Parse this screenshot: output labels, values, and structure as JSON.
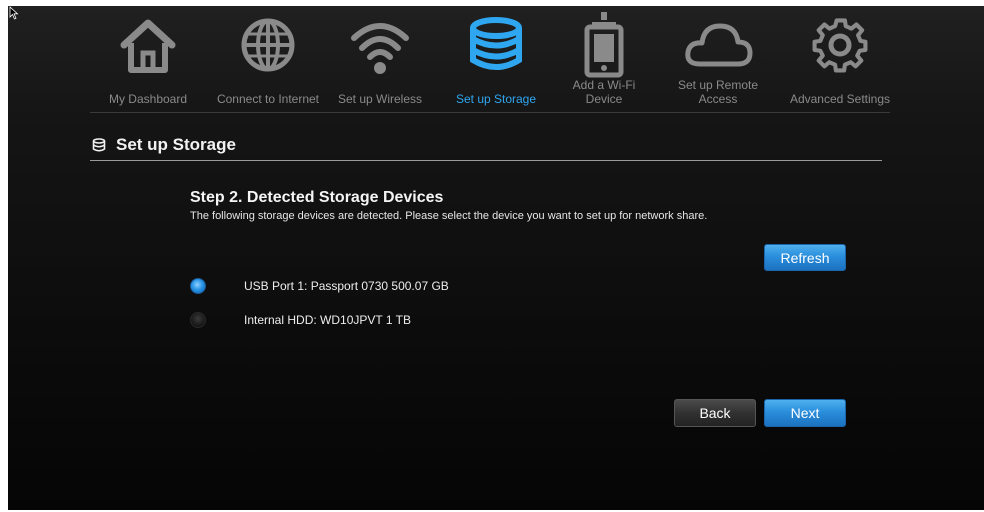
{
  "nav": {
    "items": [
      {
        "label": "My Dashboard",
        "icon": "home-icon",
        "active": false
      },
      {
        "label": "Connect to Internet",
        "icon": "globe-icon",
        "active": false
      },
      {
        "label": "Set up Wireless",
        "icon": "wifi-icon",
        "active": false
      },
      {
        "label": "Set up Storage",
        "icon": "storage-icon",
        "active": true
      },
      {
        "label": "Add a Wi-Fi\nDevice",
        "icon": "tablet-icon",
        "active": false
      },
      {
        "label": "Set up Remote\nAccess",
        "icon": "cloud-icon",
        "active": false
      },
      {
        "label": "Advanced Settings",
        "icon": "gear-icon",
        "active": false
      }
    ]
  },
  "section": {
    "title": "Set up Storage",
    "icon": "storage-icon"
  },
  "step": {
    "title": "Step 2. Detected Storage Devices",
    "description": "The following storage devices are detected. Please select the device you want to set up for network share."
  },
  "buttons": {
    "refresh": "Refresh",
    "back": "Back",
    "next": "Next"
  },
  "devices": [
    {
      "label": "USB Port 1:  Passport 0730  500.07 GB",
      "selected": true
    },
    {
      "label": "Internal HDD:  WD10JPVT 1 TB",
      "selected": false
    }
  ],
  "colors": {
    "accent": "#2fa6f0",
    "nav_inactive": "#8a8a8a",
    "button_blue": "#2a8edc",
    "background": "#0d0d0d"
  }
}
